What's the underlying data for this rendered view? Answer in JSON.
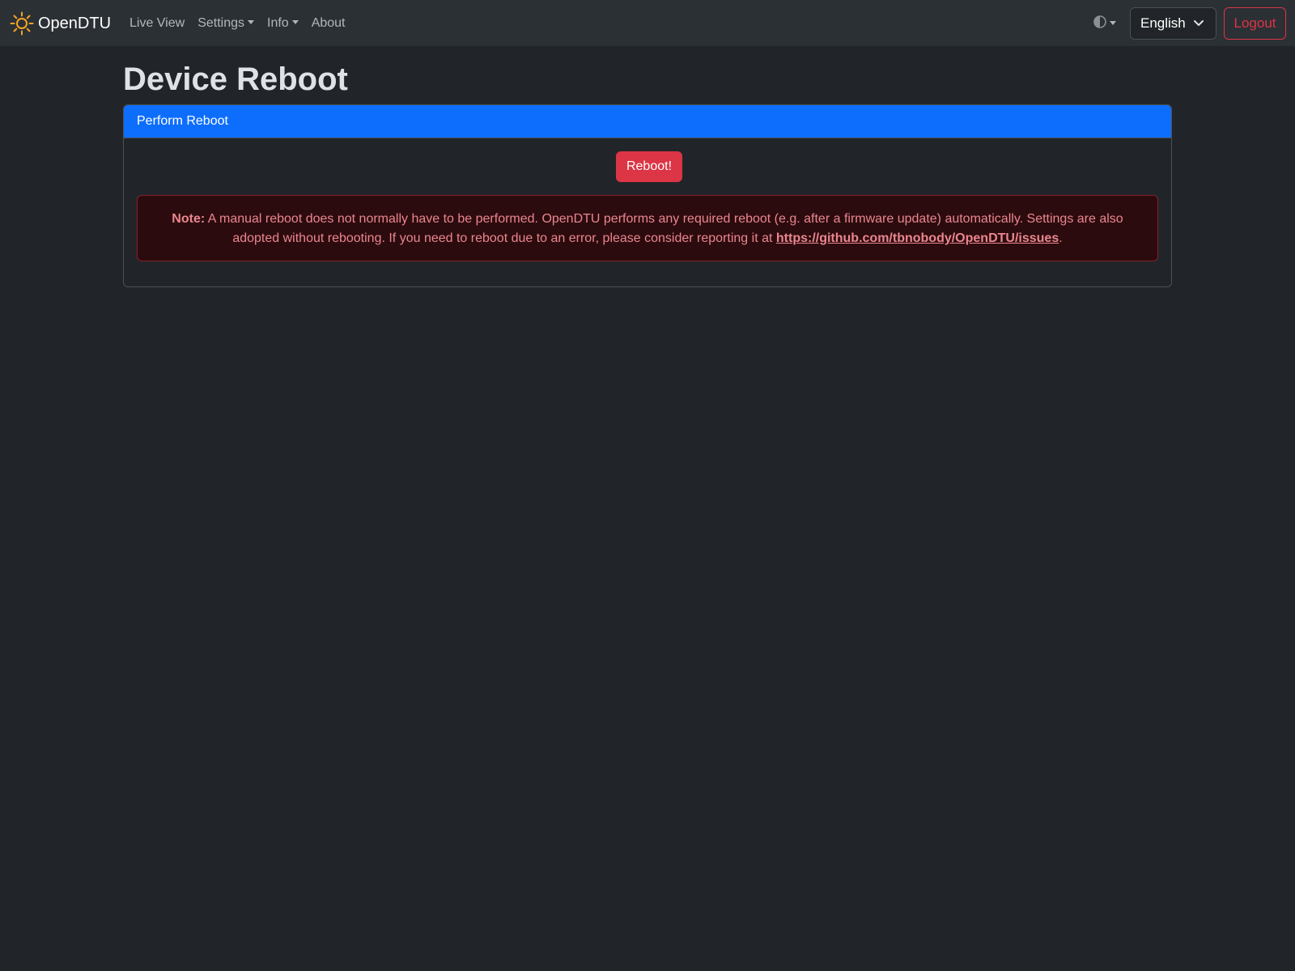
{
  "navbar": {
    "brand": "OpenDTU",
    "links": [
      {
        "label": "Live View",
        "dropdown": false
      },
      {
        "label": "Settings",
        "dropdown": true
      },
      {
        "label": "Info",
        "dropdown": true
      },
      {
        "label": "About",
        "dropdown": false
      }
    ],
    "theme_icon": "half-circle-icon",
    "language": "English",
    "logout": "Logout"
  },
  "page": {
    "title": "Device Reboot"
  },
  "card": {
    "header": "Perform Reboot",
    "reboot_button": "Reboot!",
    "note": {
      "label": "Note:",
      "text": "A manual reboot does not normally have to be performed. OpenDTU performs any required reboot (e.g. after a firmware update) automatically. Settings are also adopted without rebooting. If you need to reboot due to an error, please consider reporting it at",
      "link": "https://github.com/tbnobody/OpenDTU/issues",
      "trailing": "."
    }
  },
  "colors": {
    "background": "#212529",
    "navbar": "#2b3035",
    "primary": "#0d6efd",
    "danger": "#dc3545",
    "alert_text": "#ea868f",
    "brand_icon": "#f5a623"
  }
}
